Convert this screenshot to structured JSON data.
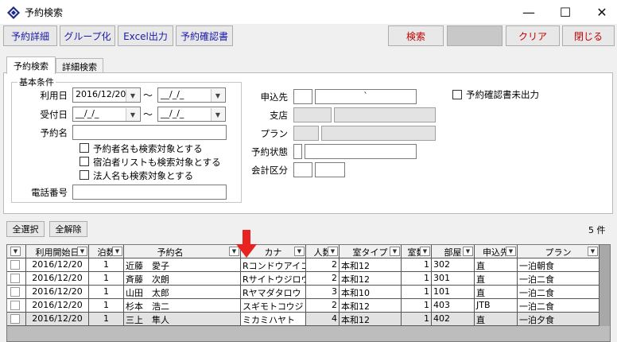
{
  "window": {
    "title": "予約検索",
    "minimize": "—",
    "maximize": "☐",
    "close": "✕"
  },
  "toolbar": {
    "detail": "予約詳細",
    "group": "グループ化",
    "excel": "Excel出力",
    "confirm_doc": "予約確認書",
    "search": "検索",
    "blank": "",
    "clear": "クリア",
    "close": "閉じる"
  },
  "tabs": [
    "予約検索",
    "詳細検索"
  ],
  "basic": {
    "group_label": "基本条件",
    "use_date_label": "利用日",
    "use_date_from": "2016/12/20",
    "use_date_to": "__/_/_",
    "accept_date_label": "受付日",
    "accept_date_from": "__/_/_",
    "accept_date_to": "__/_/_",
    "range_sep": "〜",
    "booker_label": "予約名",
    "booker_value": "",
    "cb1": "予約者名も検索対象とする",
    "cb2": "宿泊者リストも検索対象とする",
    "cb3": "法人名も検索対象とする",
    "phone_label": "電話番号",
    "phone_value": ""
  },
  "right": {
    "applicant_label": "申込先",
    "applicant_name": "`",
    "branch_label": "支店",
    "plan_label": "プラン",
    "status_label": "予約状態",
    "account_label": "会計区分",
    "confirm_unprinted": "予約確認書未出力"
  },
  "actions": {
    "select_all": "全選択",
    "deselect_all": "全解除",
    "count": "5 件"
  },
  "table": {
    "columns": [
      "利用開始日",
      "泊数",
      "予約名",
      "カナ",
      "人数",
      "室タイプ",
      "室数",
      "部屋",
      "申込先",
      "プラン"
    ],
    "rows": [
      [
        "2016/12/20",
        "1",
        "近藤　愛子",
        "Rコンドウアイコ",
        "2",
        "本和12",
        "1",
        "302",
        "直",
        "一泊朝食"
      ],
      [
        "2016/12/20",
        "1",
        "斉藤　次朗",
        "Rサイトウジロウ",
        "2",
        "本和12",
        "1",
        "301",
        "直",
        "一泊二食"
      ],
      [
        "2016/12/20",
        "1",
        "山田　太郎",
        "Rヤマダタロウ",
        "3",
        "本和10",
        "1",
        "101",
        "直",
        "一泊二食"
      ],
      [
        "2016/12/20",
        "1",
        "杉本　浩二",
        "スギモトコウジ",
        "2",
        "本和12",
        "1",
        "403",
        "JTB",
        "一泊二食"
      ],
      [
        "2016/12/20",
        "1",
        "三上　隼人",
        "ミカミハヤト",
        "4",
        "本和12",
        "1",
        "402",
        "直",
        "一泊夕食"
      ]
    ]
  },
  "colors": {
    "toolbar_blue": "#1a1aa8",
    "toolbar_red": "#c00000",
    "annotation_arrow": "#e8231f"
  },
  "icons": {
    "app": "diamond-app-icon",
    "dropdown": "chevron-down-icon",
    "annotation": "red-down-arrow-icon"
  }
}
